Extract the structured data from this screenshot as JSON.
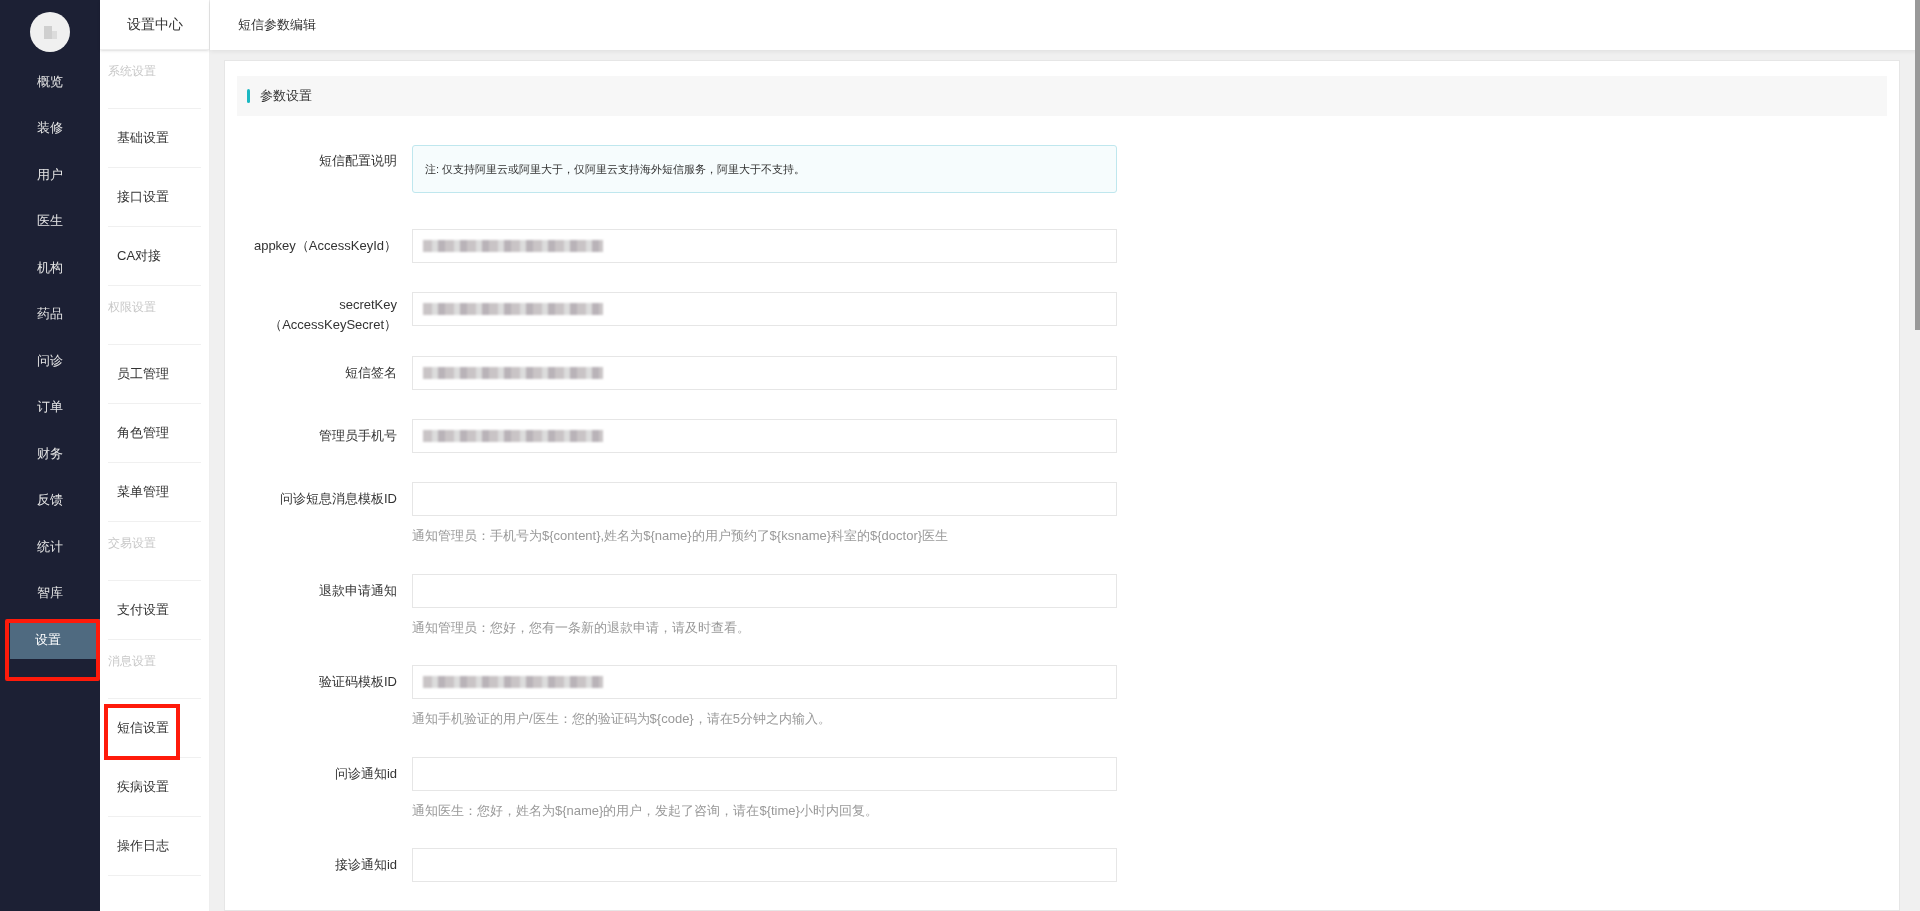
{
  "main_nav": {
    "items": [
      {
        "label": "概览",
        "selected": false,
        "highlighted": false
      },
      {
        "label": "装修",
        "selected": false,
        "highlighted": false
      },
      {
        "label": "用户",
        "selected": false,
        "highlighted": false
      },
      {
        "label": "医生",
        "selected": false,
        "highlighted": false
      },
      {
        "label": "机构",
        "selected": false,
        "highlighted": false
      },
      {
        "label": "药品",
        "selected": false,
        "highlighted": false
      },
      {
        "label": "问诊",
        "selected": false,
        "highlighted": false
      },
      {
        "label": "订单",
        "selected": false,
        "highlighted": false
      },
      {
        "label": "财务",
        "selected": false,
        "highlighted": false
      },
      {
        "label": "反馈",
        "selected": false,
        "highlighted": false
      },
      {
        "label": "统计",
        "selected": false,
        "highlighted": false
      },
      {
        "label": "智库",
        "selected": false,
        "highlighted": false
      },
      {
        "label": "设置",
        "selected": true,
        "highlighted": true
      }
    ]
  },
  "sub_nav": {
    "title": "设置中心",
    "items": [
      {
        "kind": "group",
        "label": "系统设置"
      },
      {
        "kind": "link",
        "label": "基础设置",
        "highlighted": false
      },
      {
        "kind": "link",
        "label": "接口设置",
        "highlighted": false
      },
      {
        "kind": "link",
        "label": "CA对接",
        "highlighted": false
      },
      {
        "kind": "group",
        "label": "权限设置"
      },
      {
        "kind": "link",
        "label": "员工管理",
        "highlighted": false
      },
      {
        "kind": "link",
        "label": "角色管理",
        "highlighted": false
      },
      {
        "kind": "link",
        "label": "菜单管理",
        "highlighted": false
      },
      {
        "kind": "group",
        "label": "交易设置"
      },
      {
        "kind": "link",
        "label": "支付设置",
        "highlighted": false
      },
      {
        "kind": "group",
        "label": "消息设置"
      },
      {
        "kind": "link",
        "label": "短信设置",
        "highlighted": true
      },
      {
        "kind": "link",
        "label": "疾病设置",
        "highlighted": false
      },
      {
        "kind": "link",
        "label": "操作日志",
        "highlighted": false
      }
    ]
  },
  "header": {
    "title": "短信参数编辑"
  },
  "section": {
    "title": "参数设置"
  },
  "form": {
    "rows": [
      {
        "kind": "note",
        "label": "短信配置说明",
        "text": "注: 仅支持阿里云或阿里大于，仅阿里云支持海外短信服务，阿里大于不支持。"
      },
      {
        "kind": "input",
        "label": "appkey（AccessKeyId）",
        "blurred": true
      },
      {
        "kind": "input",
        "label": "secretKey（AccessKeySecret）",
        "blurred": true
      },
      {
        "kind": "input",
        "label": "短信签名",
        "blurred": true
      },
      {
        "kind": "input",
        "label": "管理员手机号",
        "blurred": true
      },
      {
        "kind": "input",
        "label": "问诊短息消息模板ID",
        "blurred": false,
        "hint": "通知管理员：手机号为${content},姓名为${name}的用户预约了${ksname}科室的${doctor}医生"
      },
      {
        "kind": "input",
        "label": "退款申请通知",
        "blurred": false,
        "hint": "通知管理员：您好，您有一条新的退款申请，请及时查看。"
      },
      {
        "kind": "input",
        "label": "验证码模板ID",
        "blurred": true,
        "hint": "通知手机验证的用户/医生：您的验证码为${code}，请在5分钟之内输入。"
      },
      {
        "kind": "input",
        "label": "问诊通知id",
        "blurred": false,
        "hint": "通知医生：您好，姓名为${name}的用户，发起了咨询，请在${time}小时内回复。"
      },
      {
        "kind": "input",
        "label": "接诊通知id",
        "blurred": false
      }
    ]
  }
}
